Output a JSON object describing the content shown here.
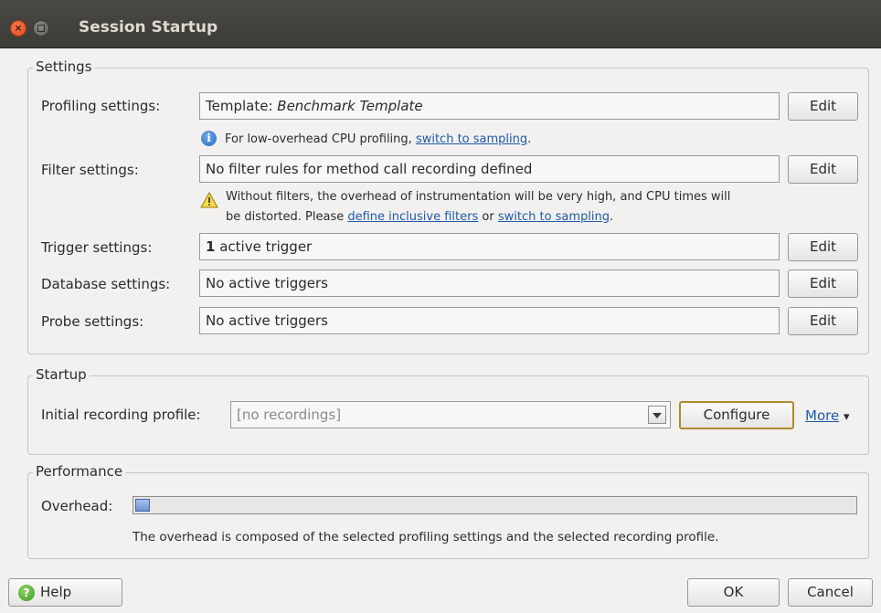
{
  "window": {
    "title": "Session Startup"
  },
  "settings": {
    "group_title": "Settings",
    "profiling": {
      "label": "Profiling settings:",
      "value_prefix": "Template: ",
      "value_name": "Benchmark Template",
      "edit_label": "Edit",
      "hint_text": "For low-overhead CPU profiling,",
      "hint_link": "switch to sampling",
      "hint_end": "."
    },
    "filter": {
      "label": "Filter settings:",
      "value": "No filter rules for method call recording defined",
      "edit_label": "Edit",
      "warning_line1": "Without filters, the overhead of instrumentation will be very high, and CPU times will",
      "warning_line2_prefix": "be distorted. Please",
      "warning_link1": "define inclusive filters",
      "warning_mid": "or",
      "warning_link2": "switch to sampling",
      "warning_end": "."
    },
    "trigger": {
      "label": "Trigger settings:",
      "count": "1",
      "value_suffix": " active trigger",
      "edit_label": "Edit"
    },
    "database": {
      "label": "Database settings:",
      "value": "No active triggers",
      "edit_label": "Edit"
    },
    "probe": {
      "label": "Probe settings:",
      "value": "No active triggers",
      "edit_label": "Edit"
    }
  },
  "startup": {
    "group_title": "Startup",
    "recording_label": "Initial recording profile:",
    "recording_value": "[no recordings]",
    "configure_label": "Configure",
    "more_label": "More",
    "more_arrow": "▾"
  },
  "performance": {
    "group_title": "Performance",
    "overhead_label": "Overhead:",
    "overhead_level": 0.02,
    "description": "The overhead is composed of the selected profiling settings and the selected recording profile."
  },
  "footer": {
    "help_label": "Help",
    "ok_label": "OK",
    "cancel_label": "Cancel"
  },
  "colors": {
    "link": "#1e5aa8",
    "titlebar": "#3c3b37",
    "close_button": "#df4a16",
    "configure_border": "#b08a2e"
  },
  "icons": {
    "close": "close-icon",
    "minimize": "minimize-icon",
    "info": "info-icon",
    "warning": "warning-icon",
    "dropdown": "chevron-down-icon",
    "help": "help-icon"
  }
}
